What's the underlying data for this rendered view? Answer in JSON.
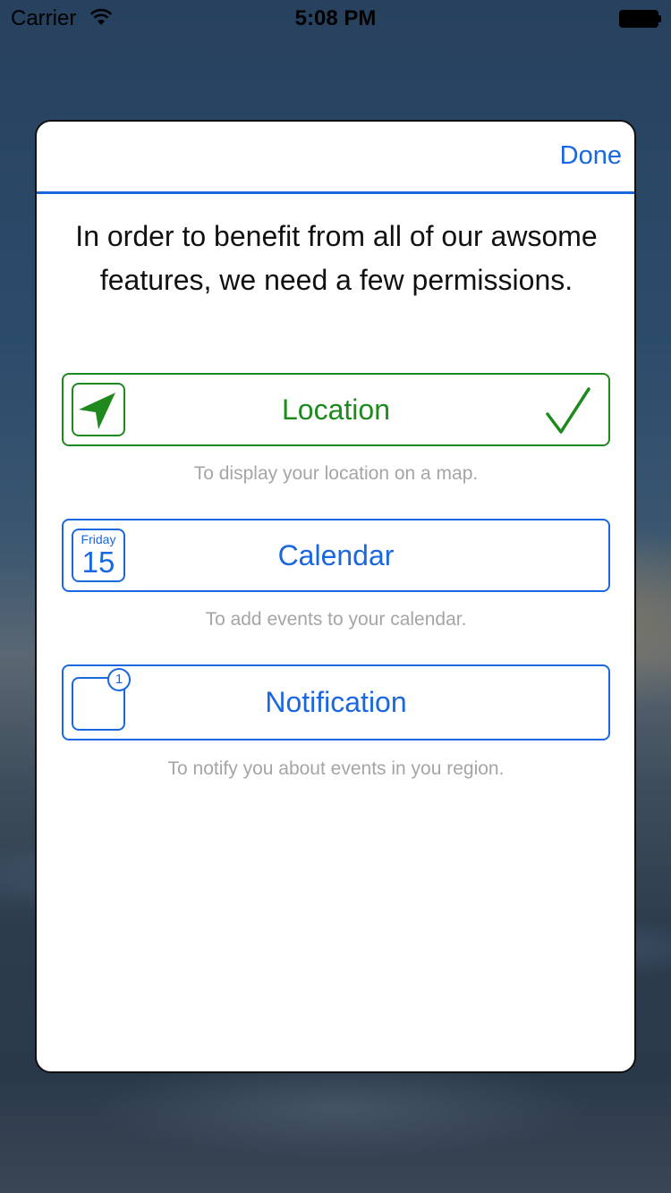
{
  "status_bar": {
    "carrier": "Carrier",
    "time": "5:08 PM"
  },
  "modal": {
    "done_label": "Done",
    "intro": "In order to benefit from all of our awsome features, we need a few permissions.",
    "accent_blue": "#1a67e0",
    "granted_green": "#1e8a1e"
  },
  "permissions": [
    {
      "label": "Location",
      "description": "To display your location on a map.",
      "icon": "location-arrow-icon",
      "granted": true
    },
    {
      "label": "Calendar",
      "description": "To add events to your calendar.",
      "icon": "calendar-icon",
      "icon_day": "Friday",
      "icon_date": "15",
      "granted": false
    },
    {
      "label": "Notification",
      "description": "To notify you about events in you region.",
      "icon": "notification-icon",
      "icon_badge": "1",
      "granted": false
    }
  ]
}
